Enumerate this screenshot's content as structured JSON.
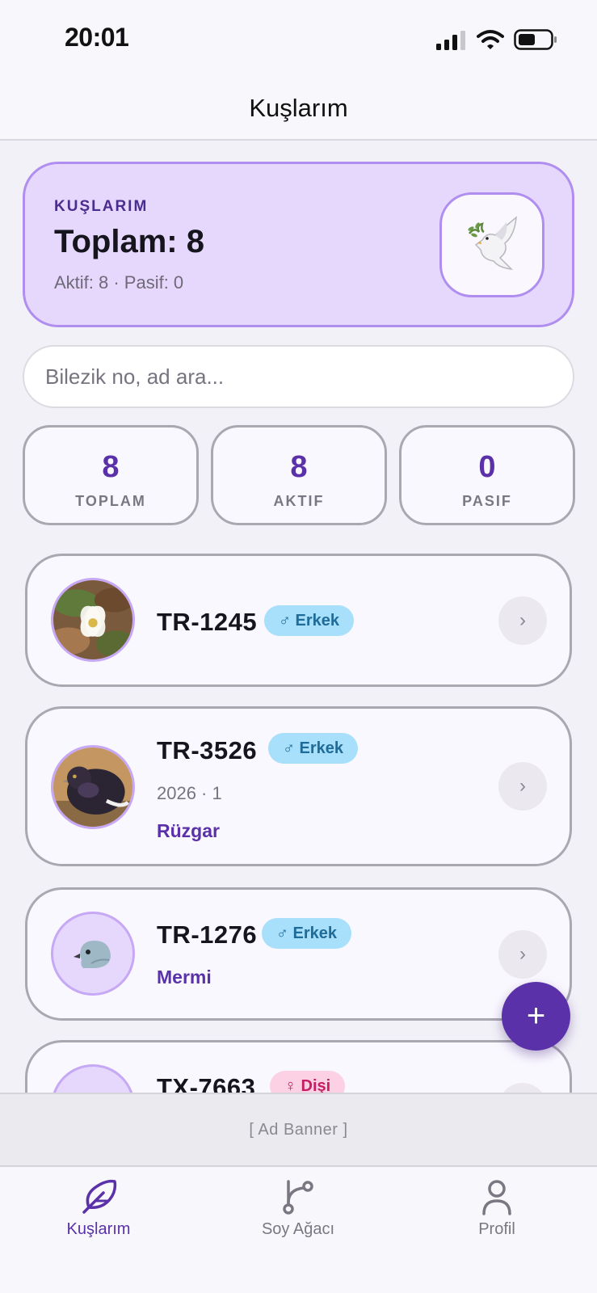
{
  "status_bar": {
    "time": "20:01"
  },
  "navbar": {
    "title": "Kuşlarım"
  },
  "hero": {
    "eyebrow": "KUŞLARIM",
    "total": "Toplam: 8",
    "sub": "Aktif: 8 · Pasif: 0",
    "icon": "dove-icon"
  },
  "search": {
    "placeholder": "Bilezik no, ad ara..."
  },
  "stats": [
    {
      "value": "8",
      "label": "TOPLAM"
    },
    {
      "value": "8",
      "label": "AKTIF"
    },
    {
      "value": "0",
      "label": "PASIF"
    }
  ],
  "birds": [
    {
      "ring": "TR-1245",
      "sex": "♂ Erkek"
    },
    {
      "ring": "TR-3526",
      "sex": "♂ Erkek",
      "meta": "2026 · 1",
      "name": "Rüzgar"
    },
    {
      "ring": "TR-1276",
      "sex": "♂ Erkek",
      "name": "Mermi"
    },
    {
      "ring": "TX-7663",
      "sex": "♀ Dişi"
    }
  ],
  "fab": {
    "label": "+"
  },
  "ad_banner": {
    "text": "[ Ad Banner ]"
  },
  "tabs": [
    {
      "label": "Kuşlarım",
      "icon": "feather-icon",
      "active": true
    },
    {
      "label": "Soy Ağacı",
      "icon": "branch-icon",
      "active": false
    },
    {
      "label": "Profil",
      "icon": "person-icon",
      "active": false
    }
  ],
  "colors": {
    "accent": "#5a31a8",
    "hero_bg": "#e6d8fc",
    "male_badge": "#a8dffa",
    "female_badge": "#fbd1e3"
  }
}
